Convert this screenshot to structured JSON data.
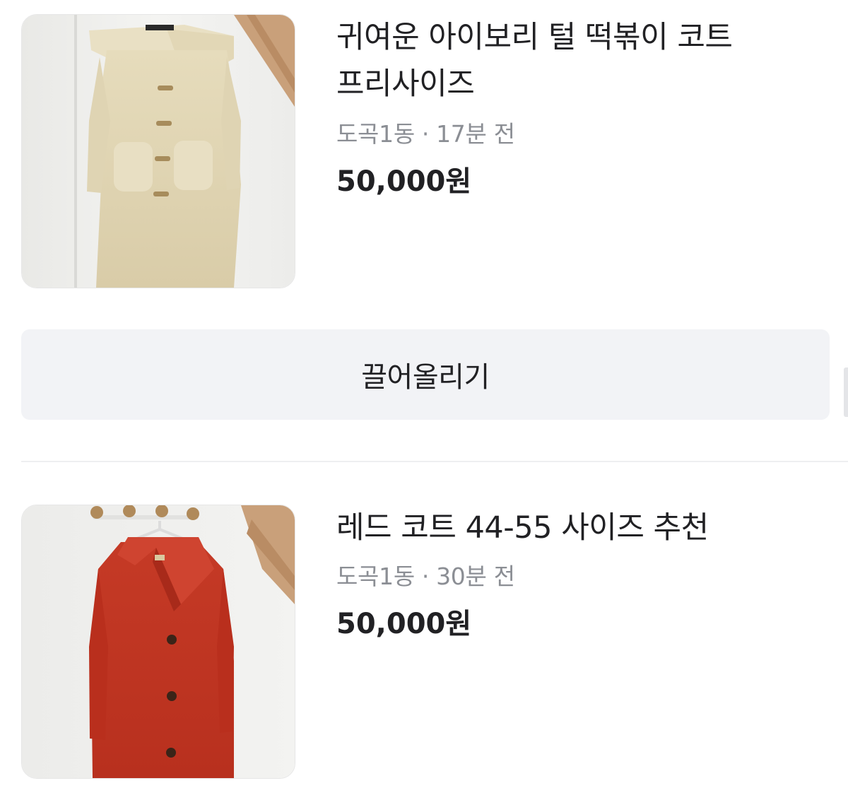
{
  "listings": [
    {
      "title_line1": "귀여운 아이보리 털 떡볶이 코트",
      "title_line2": "프리사이즈",
      "location": "도곡1동",
      "separator": "·",
      "time": "17분 전",
      "price": "50,000원",
      "photo": "ivory-fleece-duffle-coat-photo"
    },
    {
      "title_line1": "레드 코트 44-55 사이즈 추천",
      "location": "도곡1동",
      "separator": "·",
      "time": "30분 전",
      "price": "50,000원",
      "photo": "red-wool-coat-photo"
    }
  ],
  "actions": {
    "bump_label": "끌어올리기"
  },
  "colors": {
    "title": "#212124",
    "meta": "#8b8e94",
    "button_bg": "#f2f3f6",
    "divider": "#eeeff1"
  }
}
